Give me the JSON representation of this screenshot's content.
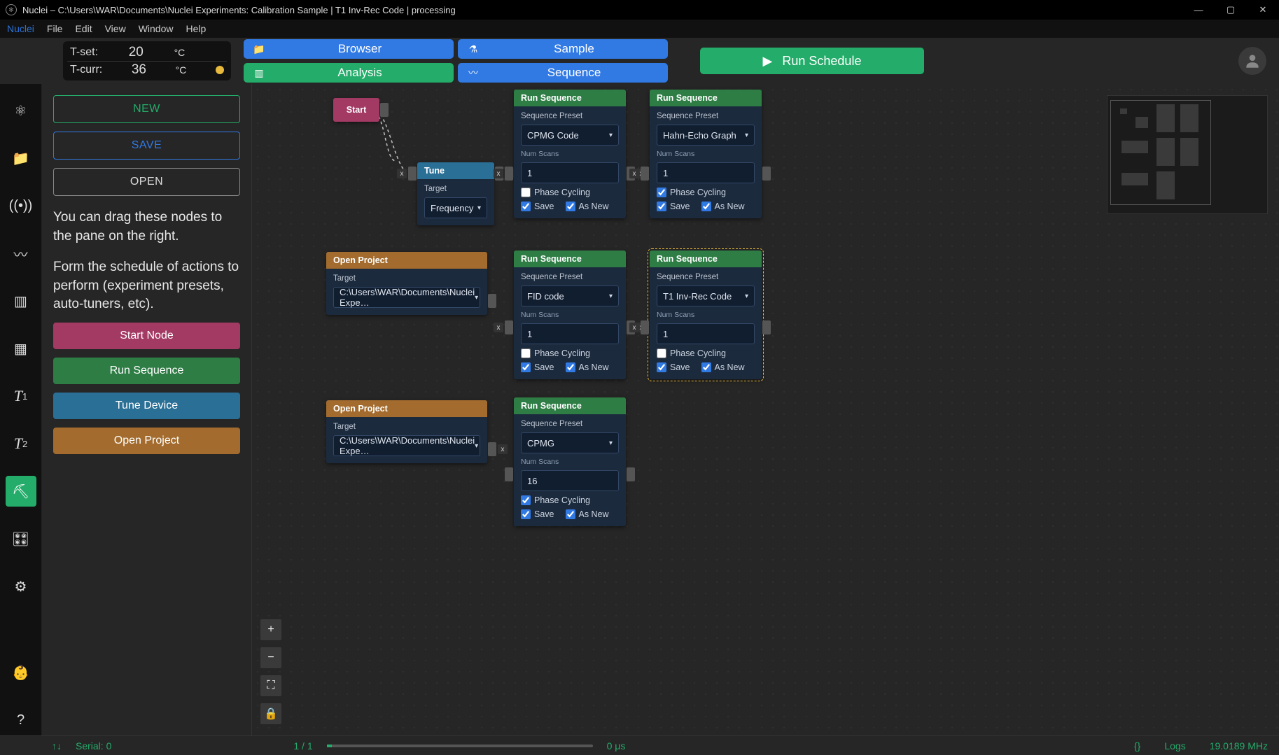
{
  "window": {
    "title": "Nuclei – C:\\Users\\WAR\\Documents\\Nuclei Experiments: Calibration Sample | T1 Inv-Rec Code | processing"
  },
  "menu": {
    "app": "Nuclei",
    "file": "File",
    "edit": "Edit",
    "view": "View",
    "window": "Window",
    "help": "Help"
  },
  "temp": {
    "set_label": "T-set:",
    "set_val": "20",
    "set_unit": "°C",
    "curr_label": "T-curr:",
    "curr_val": "36",
    "curr_unit": "°C"
  },
  "tabs": {
    "browser": "Browser",
    "sample": "Sample",
    "analysis": "Analysis",
    "sequence": "Sequence"
  },
  "run_schedule": "Run Schedule",
  "sidepane": {
    "new": "NEW",
    "save": "SAVE",
    "open": "OPEN",
    "hint1": "You can drag these nodes to the pane on the right.",
    "hint2": "Form the schedule of actions to perform (experiment presets, auto-tuners, etc).",
    "nodes": {
      "start": "Start Node",
      "run": "Run Sequence",
      "tune": "Tune Device",
      "open": "Open Project"
    }
  },
  "iconbar": {
    "science": "science-icon",
    "folder": "folder-icon",
    "broadcast": "broadcast-icon",
    "line": "line-chart-icon",
    "bar": "bar-chart-icon",
    "apps": "apps-add-icon",
    "t1": "T1",
    "t2": "T2",
    "schedule": "schedule-icon",
    "device": "device-icon",
    "settings": "settings-icon",
    "baby": "stroller-icon",
    "help": "help-icon"
  },
  "gcommon": {
    "run_title": "Run Sequence",
    "preset_label": "Sequence Preset",
    "scans_label": "Num Scans",
    "phase": "Phase Cycling",
    "save": "Save",
    "asnew": "As New",
    "tune_title": "Tune",
    "tune_target": "Target",
    "tune_value": "Frequency",
    "open_title": "Open Project",
    "open_target": "Target",
    "project_path": "C:\\Users\\WAR\\Documents\\Nuclei Expe…",
    "start": "Start"
  },
  "gnodes": {
    "run1": {
      "preset": "CPMG Code",
      "scans": "1",
      "phase": false,
      "save": true,
      "asnew": true
    },
    "run2": {
      "preset": "Hahn-Echo Graph",
      "scans": "1",
      "phase": true,
      "save": true,
      "asnew": true
    },
    "run3": {
      "preset": "FID code",
      "scans": "1",
      "phase": false,
      "save": true,
      "asnew": true
    },
    "run4": {
      "preset": "T1 Inv-Rec Code",
      "scans": "1",
      "phase": false,
      "save": true,
      "asnew": true
    },
    "run5": {
      "preset": "CPMG",
      "scans": "16",
      "phase": true,
      "save": true,
      "asnew": true
    }
  },
  "zoom": {
    "in": "+",
    "out": "−",
    "fit": "⛶",
    "lock": "🔒"
  },
  "status": {
    "serial": "Serial: 0",
    "count": "1 / 1",
    "time": "0 μs",
    "logs": "Logs",
    "freq": "19.0189 MHz",
    "arrows": "↑↓",
    "braces": "{}"
  }
}
